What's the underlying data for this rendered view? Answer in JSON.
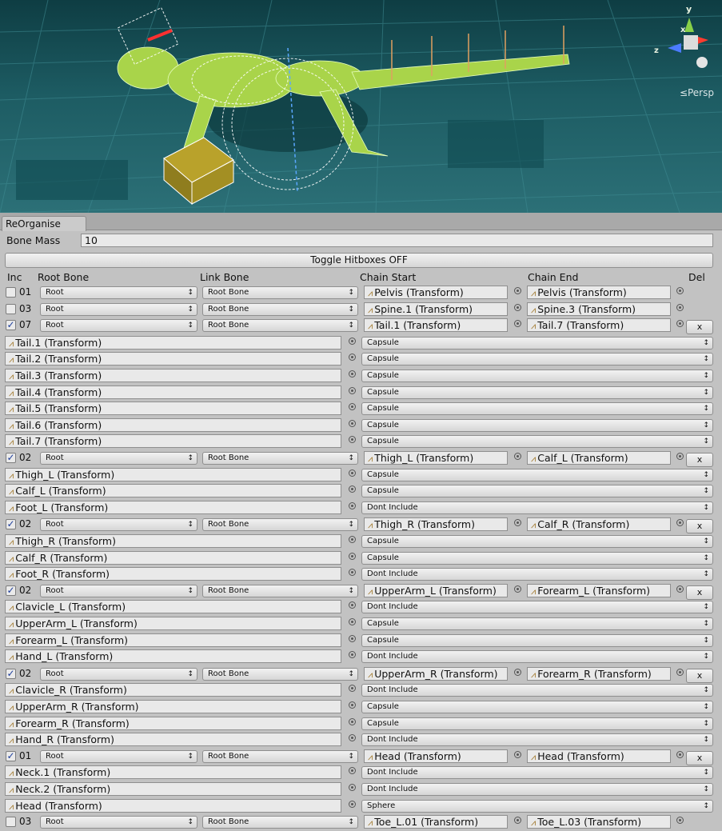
{
  "viewport": {
    "persp_label": "≤Persp",
    "axis_y": "y",
    "axis_x": "x",
    "axis_z": "z"
  },
  "tab": {
    "label": "ReOrganise"
  },
  "bone_mass": {
    "label": "Bone Mass",
    "value": "10"
  },
  "toggle_button": {
    "label": "Toggle Hitboxes OFF"
  },
  "headers": {
    "inc": "Inc",
    "root_bone": "Root Bone",
    "link_bone": "Link Bone",
    "chain_start": "Chain Start",
    "chain_end": "Chain End",
    "del": "Del"
  },
  "rows": [
    {
      "type": "chain",
      "checked": false,
      "idx": "01",
      "root": "Root",
      "link": "Root Bone",
      "start": "Pelvis (Transform)",
      "end": "Pelvis (Transform)",
      "del": false
    },
    {
      "type": "chain",
      "checked": false,
      "idx": "03",
      "root": "Root",
      "link": "Root Bone",
      "start": "Spine.1 (Transform)",
      "end": "Spine.3 (Transform)",
      "del": false
    },
    {
      "type": "chain",
      "checked": true,
      "idx": "07",
      "root": "Root",
      "link": "Root Bone",
      "start": "Tail.1 (Transform)",
      "end": "Tail.7 (Transform)",
      "del": true
    },
    {
      "type": "bone",
      "name": "Tail.1 (Transform)",
      "shape": "Capsule"
    },
    {
      "type": "bone",
      "name": "Tail.2 (Transform)",
      "shape": "Capsule"
    },
    {
      "type": "bone",
      "name": "Tail.3 (Transform)",
      "shape": "Capsule"
    },
    {
      "type": "bone",
      "name": "Tail.4 (Transform)",
      "shape": "Capsule"
    },
    {
      "type": "bone",
      "name": "Tail.5 (Transform)",
      "shape": "Capsule"
    },
    {
      "type": "bone",
      "name": "Tail.6 (Transform)",
      "shape": "Capsule"
    },
    {
      "type": "bone",
      "name": "Tail.7 (Transform)",
      "shape": "Capsule"
    },
    {
      "type": "chain",
      "checked": true,
      "idx": "02",
      "root": "Root",
      "link": "Root Bone",
      "start": "Thigh_L (Transform)",
      "end": "Calf_L (Transform)",
      "del": true
    },
    {
      "type": "bone",
      "name": "Thigh_L (Transform)",
      "shape": "Capsule"
    },
    {
      "type": "bone",
      "name": "Calf_L (Transform)",
      "shape": "Capsule"
    },
    {
      "type": "bone",
      "name": "Foot_L (Transform)",
      "shape": "Dont Include"
    },
    {
      "type": "chain",
      "checked": true,
      "idx": "02",
      "root": "Root",
      "link": "Root Bone",
      "start": "Thigh_R (Transform)",
      "end": "Calf_R (Transform)",
      "del": true
    },
    {
      "type": "bone",
      "name": "Thigh_R (Transform)",
      "shape": "Capsule"
    },
    {
      "type": "bone",
      "name": "Calf_R (Transform)",
      "shape": "Capsule"
    },
    {
      "type": "bone",
      "name": "Foot_R (Transform)",
      "shape": "Dont Include"
    },
    {
      "type": "chain",
      "checked": true,
      "idx": "02",
      "root": "Root",
      "link": "Root Bone",
      "start": "UpperArm_L (Transform)",
      "end": "Forearm_L (Transform)",
      "del": true
    },
    {
      "type": "bone",
      "name": "Clavicle_L (Transform)",
      "shape": "Dont Include"
    },
    {
      "type": "bone",
      "name": "UpperArm_L (Transform)",
      "shape": "Capsule"
    },
    {
      "type": "bone",
      "name": "Forearm_L (Transform)",
      "shape": "Capsule"
    },
    {
      "type": "bone",
      "name": "Hand_L (Transform)",
      "shape": "Dont Include"
    },
    {
      "type": "chain",
      "checked": true,
      "idx": "02",
      "root": "Root",
      "link": "Root Bone",
      "start": "UpperArm_R (Transform)",
      "end": "Forearm_R (Transform)",
      "del": true
    },
    {
      "type": "bone",
      "name": "Clavicle_R (Transform)",
      "shape": "Dont Include"
    },
    {
      "type": "bone",
      "name": "UpperArm_R (Transform)",
      "shape": "Capsule"
    },
    {
      "type": "bone",
      "name": "Forearm_R (Transform)",
      "shape": "Capsule"
    },
    {
      "type": "bone",
      "name": "Hand_R (Transform)",
      "shape": "Dont Include"
    },
    {
      "type": "chain",
      "checked": true,
      "idx": "01",
      "root": "Root",
      "link": "Root Bone",
      "start": "Head (Transform)",
      "end": "Head (Transform)",
      "del": true
    },
    {
      "type": "bone",
      "name": "Neck.1 (Transform)",
      "shape": "Dont Include"
    },
    {
      "type": "bone",
      "name": "Neck.2 (Transform)",
      "shape": "Dont Include"
    },
    {
      "type": "bone",
      "name": "Head (Transform)",
      "shape": "Sphere"
    },
    {
      "type": "chain",
      "checked": false,
      "idx": "03",
      "root": "Root",
      "link": "Root Bone",
      "start": "Toe_L.01 (Transform)",
      "end": "Toe_L.03 (Transform)",
      "del": false
    }
  ],
  "del_label": "x",
  "popup_arrow": "↕"
}
